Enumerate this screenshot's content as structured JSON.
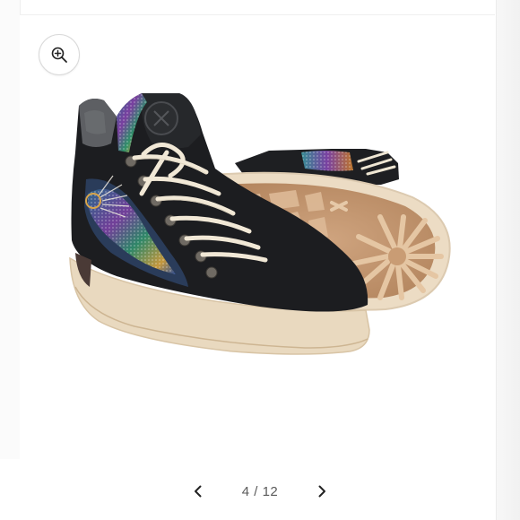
{
  "gallery": {
    "current": "4",
    "separator": "/",
    "total": "12",
    "prev_icon": "chevron-left-icon",
    "next_icon": "chevron-right-icon",
    "zoom_icon": "zoom-in-icon"
  },
  "colors": {
    "suede": "#1c1d20",
    "sole": "#eadcc6",
    "sole_tread": "#c49b77",
    "lace": "#f1e8d6",
    "accent_text": "#5a5a5a"
  }
}
